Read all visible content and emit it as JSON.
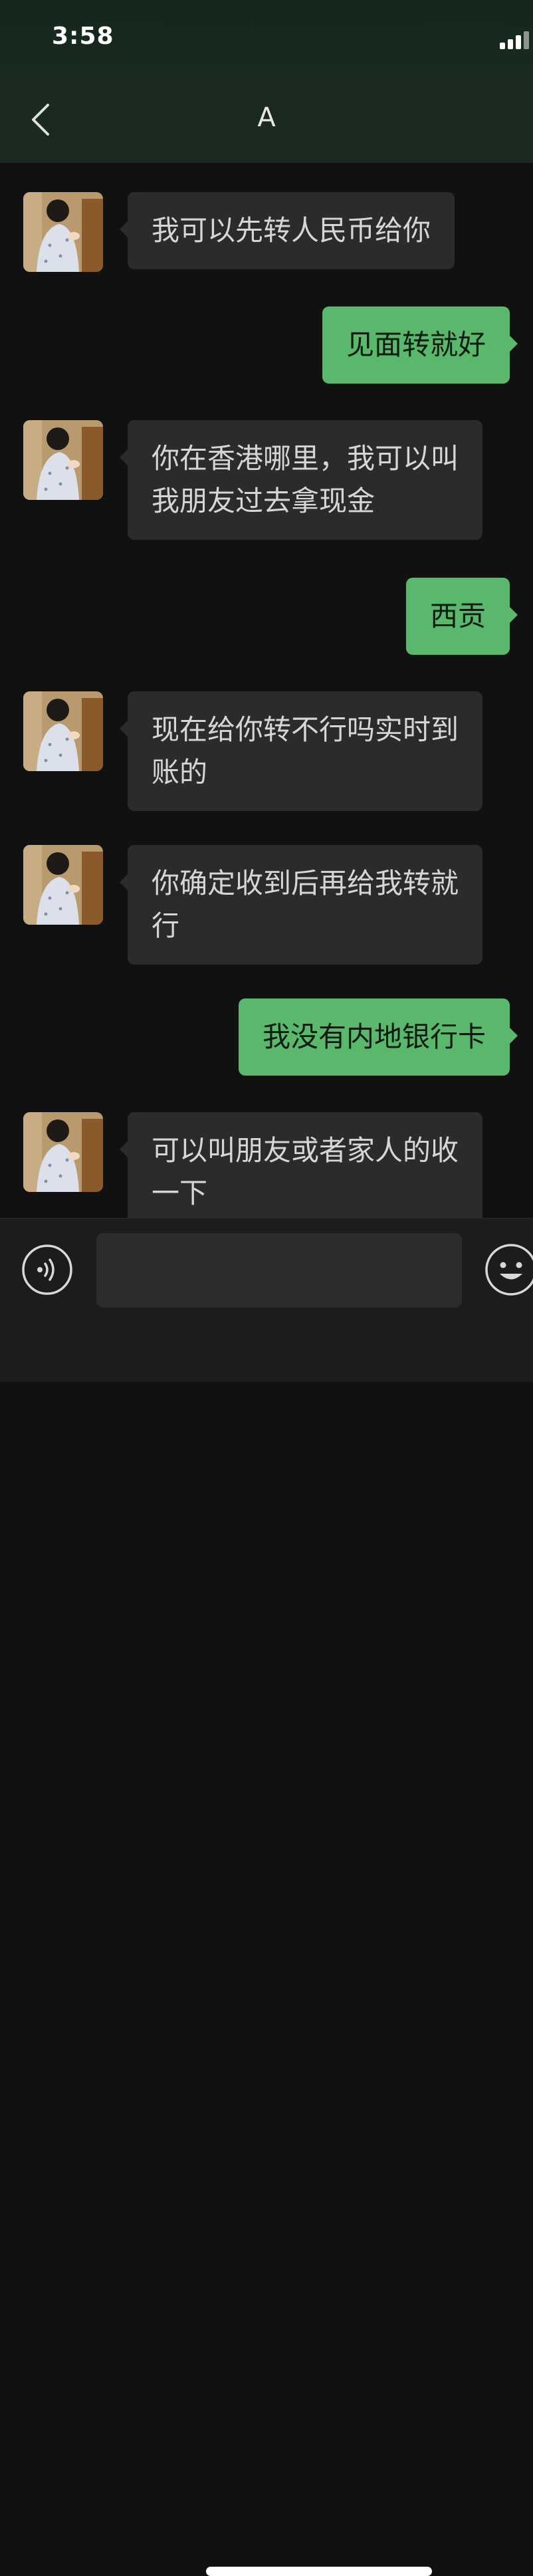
{
  "status_bar": {
    "time": "3:58"
  },
  "header": {
    "title": "A"
  },
  "messages": [
    {
      "from": "contact",
      "text": "我可以先转人民币给你"
    },
    {
      "from": "me",
      "text": "见面转就好"
    },
    {
      "from": "contact",
      "text": "你在香港哪里，我可以叫\n我朋友过去拿现金"
    },
    {
      "from": "me",
      "text": "西贡"
    },
    {
      "from": "contact",
      "text": "现在给你转不行吗实时到\n账的"
    },
    {
      "from": "contact",
      "text": "你确定收到后再给我转就\n行"
    },
    {
      "from": "me",
      "text": "我没有内地银行卡"
    },
    {
      "from": "contact",
      "text": "可以叫朋友或者家人的收\n一下"
    }
  ],
  "input_bar": {
    "placeholder": "",
    "voice_icon": "voice-icon",
    "emoji_icon": "emoji-icon"
  },
  "colors": {
    "incoming_bubble": "#2b2b2b",
    "outgoing_bubble": "#5ab86c",
    "background": "#111111"
  }
}
